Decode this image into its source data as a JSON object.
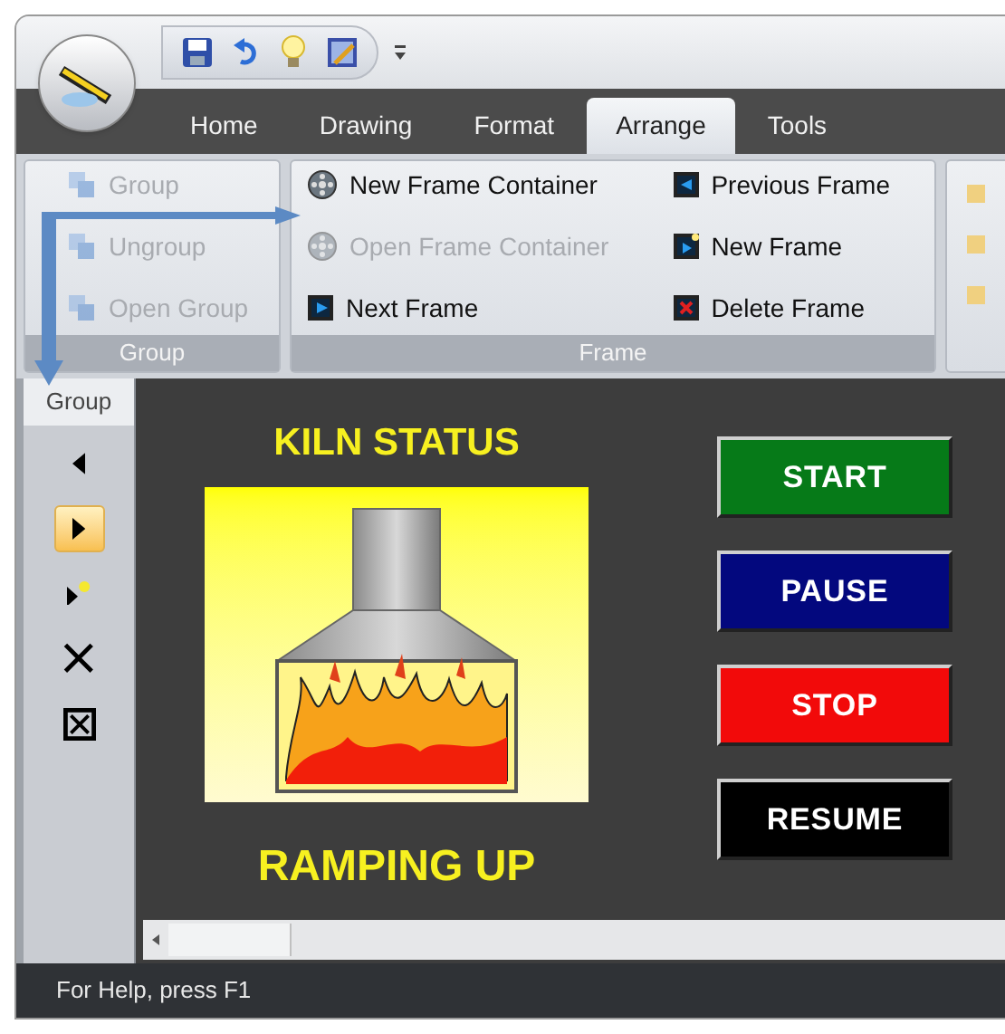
{
  "tabs": [
    {
      "label": "Home",
      "selected": false
    },
    {
      "label": "Drawing",
      "selected": false
    },
    {
      "label": "Format",
      "selected": false
    },
    {
      "label": "Arrange",
      "selected": true
    },
    {
      "label": "Tools",
      "selected": false
    }
  ],
  "ribbon": {
    "groups": [
      {
        "title": "Group",
        "items": [
          {
            "label": "Group",
            "kind": "group",
            "disabled": true
          },
          {
            "label": "Ungroup",
            "kind": "ungroup",
            "disabled": true
          },
          {
            "label": "Open Group",
            "kind": "open-group",
            "disabled": true
          }
        ]
      },
      {
        "title": "Frame",
        "items": [
          {
            "label": "New Frame Container",
            "kind": "container",
            "disabled": false
          },
          {
            "label": "Open Frame Container",
            "kind": "open-container",
            "disabled": true
          },
          {
            "label": "Next Frame",
            "kind": "next",
            "disabled": false
          },
          {
            "label": "Previous Frame",
            "kind": "previous",
            "disabled": false
          },
          {
            "label": "New Frame",
            "kind": "new",
            "disabled": false
          },
          {
            "label": "Delete Frame",
            "kind": "delete",
            "disabled": false
          }
        ]
      }
    ]
  },
  "side_toolbar": {
    "title": "Group",
    "items": [
      {
        "kind": "previous",
        "selected": false
      },
      {
        "kind": "next",
        "selected": true
      },
      {
        "kind": "new",
        "selected": false
      },
      {
        "kind": "delete",
        "selected": false
      },
      {
        "kind": "delete-all",
        "selected": false
      }
    ]
  },
  "canvas": {
    "title": "KILN STATUS",
    "status": "RAMPING UP",
    "buttons": [
      {
        "label": "START",
        "color": "#067a18"
      },
      {
        "label": "PAUSE",
        "color": "#03087e"
      },
      {
        "label": "STOP",
        "color": "#f20a0a"
      },
      {
        "label": "RESUME",
        "color": "#000000"
      }
    ]
  },
  "status_bar": "For Help, press F1"
}
